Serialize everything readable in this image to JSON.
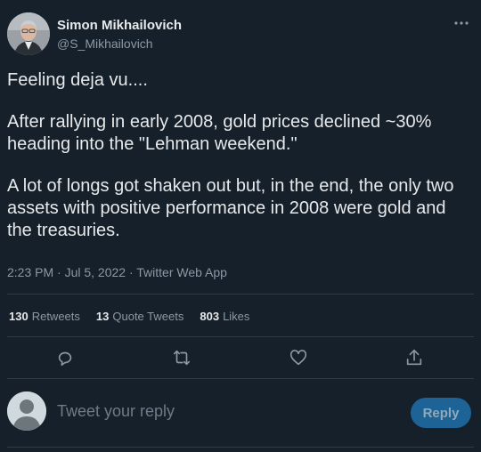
{
  "author": {
    "name": "Simon Mikhailovich",
    "handle": "@S_Mikhailovich"
  },
  "more_icon": "more-horizontal-icon",
  "tweet": {
    "paragraphs": [
      "Feeling deja vu....",
      "After rallying in early 2008, gold prices declined ~30% heading into the \"Lehman weekend.\"",
      "A lot of longs got shaken out but, in the end, the only two assets with positive performance in 2008 were gold and the treasuries."
    ],
    "meta": "2:23 PM · Jul 5, 2022 · Twitter Web App"
  },
  "stats": {
    "retweets_count": "130",
    "retweets_label": "Retweets",
    "quotes_count": "13",
    "quotes_label": "Quote Tweets",
    "likes_count": "803",
    "likes_label": "Likes"
  },
  "actions": [
    "reply-icon",
    "retweet-icon",
    "like-icon",
    "share-icon"
  ],
  "reply": {
    "placeholder": "Tweet your reply",
    "button_label": "Reply"
  },
  "colors": {
    "background": "#15202b",
    "text": "#e7e9ea",
    "muted": "#8b98a5",
    "accent": "#1d9bf0",
    "reply_button_disabled": "#1d6396"
  }
}
